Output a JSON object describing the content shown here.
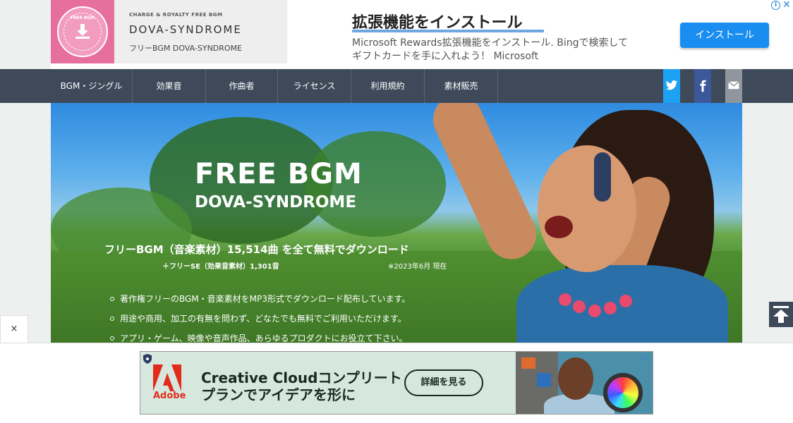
{
  "header": {
    "badge_top": "FREE BGM",
    "tagline": "CHARGE & ROYALTY FREE BGM",
    "site_name": "DOVA-SYNDROME",
    "site_sub": "フリーBGM DOVA-SYNDROME"
  },
  "top_ad": {
    "title": "拡張機能をインストール",
    "line1": "Microsoft Rewards拡張機能をインストール. Bingで検索して",
    "line2": "ギフトカードを手に入れよう！ Microsoft",
    "cta": "インストール",
    "info_icon": "info-icon",
    "close_icon": "close-icon"
  },
  "nav": {
    "items": [
      {
        "label": "BGM・ジングル"
      },
      {
        "label": "効果音"
      },
      {
        "label": "作曲者"
      },
      {
        "label": "ライセンス"
      },
      {
        "label": "利用規約"
      },
      {
        "label": "素材販売"
      }
    ],
    "social": [
      "twitter-icon",
      "facebook-icon",
      "mail-icon"
    ]
  },
  "hero": {
    "title": "FREE BGM",
    "subtitle": "DOVA-SYNDROME",
    "count": "フリーBGM（音楽素材）15,514曲 を全て無料でダウンロード",
    "se": "＋フリーSE（効果音素材）1,301音",
    "date": "※2023年6月 現在",
    "bullets": [
      "著作権フリーのBGM・音楽素材をMP3形式でダウンロード配布しています。",
      "用途や商用、加工の有無を問わず、どなたでも無料でご利用いただけます。",
      "アプリ・ゲーム、映像や音声作品、あらゆるプロダクトにお役立て下さい。"
    ]
  },
  "bottom_ad": {
    "close": "×",
    "brand": "Adobe",
    "title1": "Creative Cloudコンプリート",
    "title2": "プランでアイデアを形に",
    "cta": "詳細を見る"
  },
  "colors": {
    "nav_bg": "#3e4a5a",
    "accent_blue": "#1a8ef0",
    "logo_pink": "#e66fa0",
    "twitter": "#1da1f2",
    "facebook": "#3b5998"
  }
}
